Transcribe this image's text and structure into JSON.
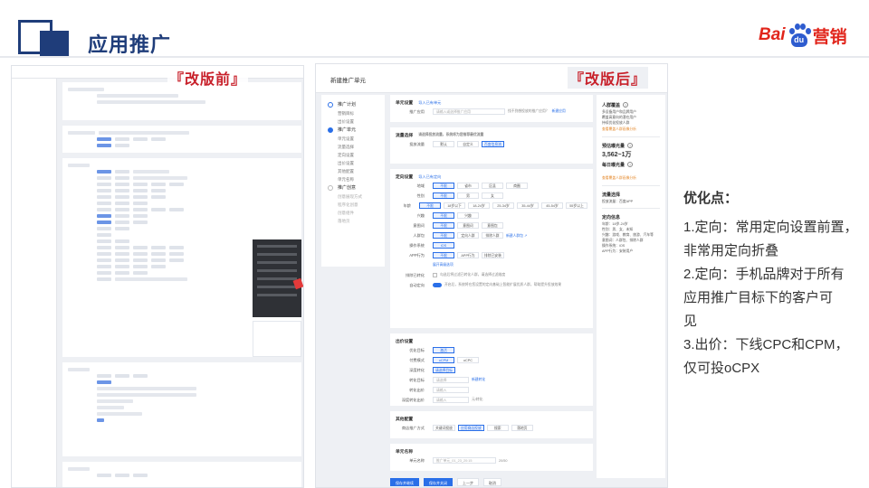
{
  "header": {
    "title": "应用推广",
    "logo_bai": "Bai",
    "logo_du": "du",
    "logo_yx": "营销"
  },
  "tags": {
    "before": "『改版前』",
    "after": "『改版后』"
  },
  "after_ui": {
    "window_title": "新建推广单元",
    "steps": [
      {
        "label": "推广计划",
        "subs": [
          "营销目标",
          "出价设置"
        ]
      },
      {
        "label": "推广单元",
        "subs": [
          "单元设置",
          "流量选择",
          "定向设置",
          "出价设置",
          "其他配置",
          "单元名称"
        ]
      },
      {
        "label": "推广创意",
        "subs": [
          "创意展现方式",
          "程序化创意",
          "创意组件",
          "落地页"
        ]
      }
    ],
    "unit_settings": {
      "title": "单元设置",
      "title_link": "导入已有单元",
      "promote_label": "推广应用",
      "promote_placeholder": "请输入或选择推广应用",
      "promote_hint": "找不到想投放的推广应用？",
      "promote_hint_link": "新建应用"
    },
    "traffic": {
      "title": "流量选择",
      "hint": "请选择投放流量，系统将为您推荐最优流量",
      "label": "投放流量",
      "options": [
        "默认",
        "自定义",
        "百度信息流"
      ]
    },
    "targeting": {
      "title": "定向设置",
      "title_link": "导入已有定向",
      "rows": [
        {
          "label": "地域",
          "options": [
            "不限",
            "省市",
            "区县",
            "商圈"
          ]
        },
        {
          "label": "性别",
          "options": [
            "不限",
            "男",
            "女"
          ]
        },
        {
          "label": "年龄",
          "options": [
            "不限",
            "18岁以下",
            "18-24岁",
            "25-34岁",
            "35-44岁",
            "45-54岁",
            "55岁以上"
          ]
        },
        {
          "label": "兴趣",
          "options": [
            "不限",
            "兴趣"
          ]
        },
        {
          "label": "意图词",
          "options": [
            "不限",
            "意图词",
            "意图包"
          ]
        },
        {
          "label": "人群包",
          "options": [
            "不限",
            "定向人群",
            "排除人群"
          ],
          "link": "新建人群包 ↗"
        },
        {
          "label": "操作系统",
          "options": [
            "iOS"
          ]
        },
        {
          "label": "APP行为",
          "options": [
            "不限",
            "APP行为",
            "排除已安装"
          ]
        }
      ],
      "more_link": "展开高级选项",
      "auto_label": "自动定向",
      "auto_text": "开启后，系统将在您设置的定向基础上智能扩展优质人群，帮助提升投放效果",
      "exclude_label": "排除已转化",
      "exclude_text": "勾选后将过滤已转化人群，请选择过滤维度"
    },
    "bidding": {
      "title": "出价设置",
      "rows": [
        {
          "label": "优化目标",
          "value": "激活"
        },
        {
          "label": "付费模式",
          "options": [
            "oCPM",
            "oCPC"
          ]
        },
        {
          "label": "深度转化",
          "value": "请选择目标"
        },
        {
          "label": "转化目标",
          "placeholder": "请选择",
          "link": "新建转化"
        },
        {
          "label": "转化出价",
          "placeholder": "请输入"
        },
        {
          "label": "深度转化出价",
          "placeholder": "请输入",
          "unit": "元/转化"
        }
      ]
    },
    "other": {
      "title": "其他配置",
      "label": "商店推广方式",
      "options": [
        "关键词投放",
        "应用商店投放",
        "搜索",
        "落地页"
      ]
    },
    "unit_name": {
      "title": "单元名称",
      "label": "单元名称",
      "placeholder": "推广单元_01_23_20:15",
      "count": "20/50"
    },
    "buttons": [
      "保存并继续",
      "保存并关闭",
      "上一步",
      "取消"
    ],
    "panel": {
      "audience_title": "人群覆盖",
      "audience_lines": [
        "多设备用户和品牌用户",
        "覆盖高意向的潜在用户",
        "持续优化投放人群"
      ],
      "audience_link": "查看覆盖人群画像分析",
      "estimate_title": "预估曝光量",
      "estimate_value": "3,562~1万",
      "daily_title": "每日曝光量",
      "daily_link": "查看覆盖人群画像分析",
      "traffic_title": "流量选择",
      "traffic_text": "投放流量：百度APP",
      "targeting_title": "定向信息",
      "targeting_lines": [
        "年龄：18岁-24岁",
        "性别：男、女、未知",
        "兴趣：游戏、教育、旅游、汽车等",
        "意图词：人群包、排除人群",
        "操作系统：iOS",
        "APP行为：安装用户"
      ]
    }
  },
  "notes": {
    "title": "优化点：",
    "lines": [
      "1.定向：常用定向设置前置，",
      "非常用定向折叠",
      "2.定向：手机品牌对于所有",
      "应用推广目标下的客户可",
      "见",
      "3.出价：下线CPC和CPM，",
      "仅可投oCPX"
    ]
  },
  "colors": {
    "brand": "#1f3d7a",
    "accent": "#c8212b",
    "link": "#2a6fe8"
  }
}
